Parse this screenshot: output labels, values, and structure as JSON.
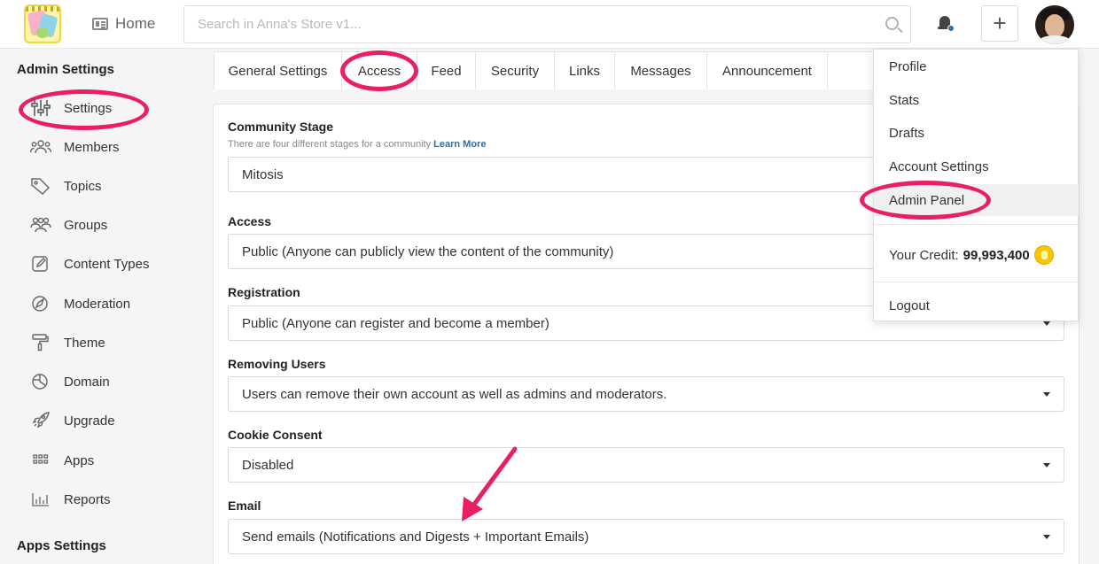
{
  "header": {
    "home_label": "Home",
    "search_placeholder": "Search in Anna's Store v1...",
    "plus_label": "+"
  },
  "sidebar": {
    "admin_title": "Admin Settings",
    "items": [
      {
        "label": "Settings",
        "icon": "sliders-icon"
      },
      {
        "label": "Members",
        "icon": "users-icon"
      },
      {
        "label": "Topics",
        "icon": "tag-icon"
      },
      {
        "label": "Groups",
        "icon": "groups-icon"
      },
      {
        "label": "Content Types",
        "icon": "edit-icon"
      },
      {
        "label": "Moderation",
        "icon": "moderation-icon"
      },
      {
        "label": "Theme",
        "icon": "paint-roller-icon"
      },
      {
        "label": "Domain",
        "icon": "globe-icon"
      },
      {
        "label": "Upgrade",
        "icon": "rocket-icon"
      },
      {
        "label": "Apps",
        "icon": "grid-icon"
      },
      {
        "label": "Reports",
        "icon": "bar-chart-icon"
      }
    ],
    "apps_title": "Apps Settings"
  },
  "tabs": [
    "General Settings",
    "Access",
    "Feed",
    "Security",
    "Links",
    "Messages",
    "Announcement"
  ],
  "active_tab": "Access",
  "form": {
    "community_stage": {
      "label": "Community Stage",
      "helper": "There are four different stages for a community",
      "helper_link": "Learn More",
      "value": "Mitosis"
    },
    "access": {
      "label": "Access",
      "value": "Public (Anyone can publicly view the content of the community)"
    },
    "registration": {
      "label": "Registration",
      "value": "Public (Anyone can register and become a member)"
    },
    "removing_users": {
      "label": "Removing Users",
      "value": "Users can remove their own account as well as admins and moderators."
    },
    "cookie_consent": {
      "label": "Cookie Consent",
      "value": "Disabled"
    },
    "email": {
      "label": "Email",
      "value": "Send emails (Notifications and Digests + Important Emails)"
    }
  },
  "menu": {
    "items": [
      "Profile",
      "Stats",
      "Drafts",
      "Account Settings",
      "Admin Panel"
    ],
    "credit_label": "Your Credit:",
    "credit_value": "99,993,400",
    "logout": "Logout"
  },
  "colors": {
    "accent": "#2d6ea8",
    "annotation": "#e91e63"
  }
}
